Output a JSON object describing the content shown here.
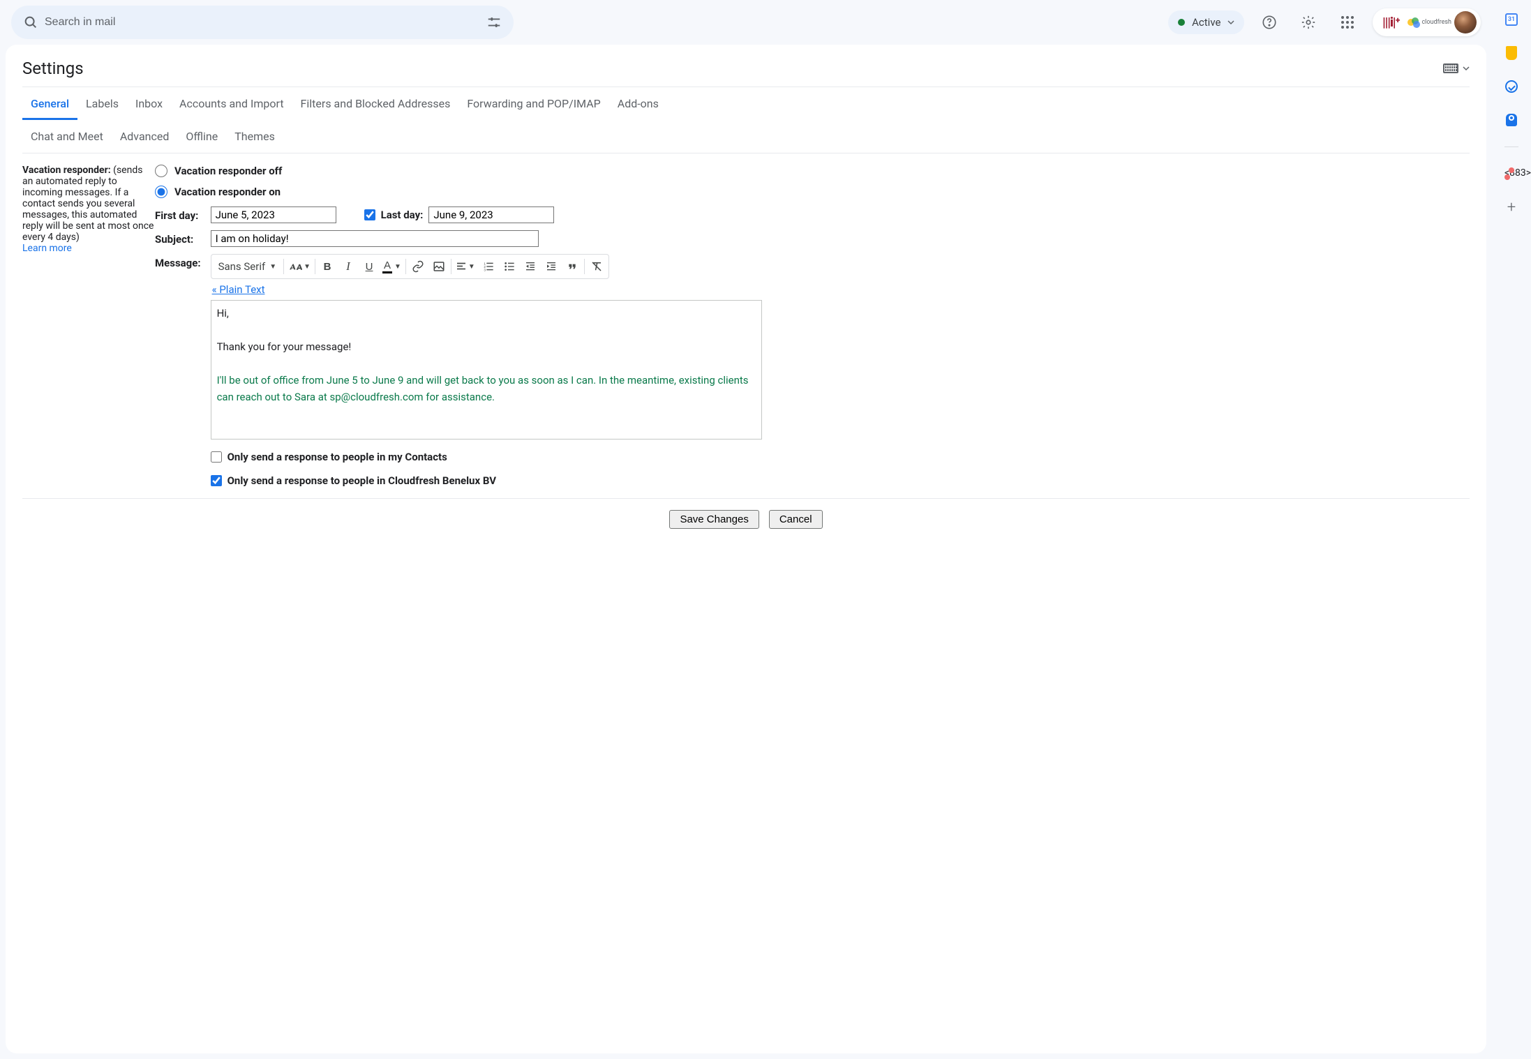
{
  "header": {
    "search_placeholder": "Search in mail",
    "status": "Active",
    "cloudfresh": "cloudfresh"
  },
  "settings": {
    "title": "Settings",
    "tabs_row1": [
      "General",
      "Labels",
      "Inbox",
      "Accounts and Import",
      "Filters and Blocked Addresses",
      "Forwarding and POP/IMAP",
      "Add-ons"
    ],
    "tabs_row2": [
      "Chat and Meet",
      "Advanced",
      "Offline",
      "Themes"
    ],
    "active_tab": "General"
  },
  "vacation": {
    "section_title": "Vacation responder:",
    "section_desc": "(sends an automated reply to incoming messages. If a contact sends you several messages, this automated reply will be sent at most once every 4 days)",
    "learn_more": "Learn more",
    "off_label": "Vacation responder off",
    "on_label": "Vacation responder on",
    "selected": "on",
    "first_day_label": "First day:",
    "first_day": "June 5, 2023",
    "last_day_enabled": true,
    "last_day_label": "Last day:",
    "last_day": "June 9, 2023",
    "subject_label": "Subject:",
    "subject": "I am on holiday!",
    "message_label": "Message:",
    "font": "Sans Serif",
    "plain_text": "« Plain Text",
    "body_line1": "Hi,",
    "body_line2": "Thank you for your message!",
    "body_line3": "I'll be out of office from June 5 to June 9 and will get back to you as soon as I can. In the meantime, existing clients can reach out to Sara at sp@cloudfresh.com for assistance.",
    "contacts_only_label": "Only send a response to people in my Contacts",
    "contacts_only": false,
    "domain_only_label": "Only send a response to people in Cloudfresh Benelux BV",
    "domain_only": true
  },
  "actions": {
    "save": "Save Changes",
    "cancel": "Cancel"
  },
  "side": {
    "calendar_day": "31"
  }
}
